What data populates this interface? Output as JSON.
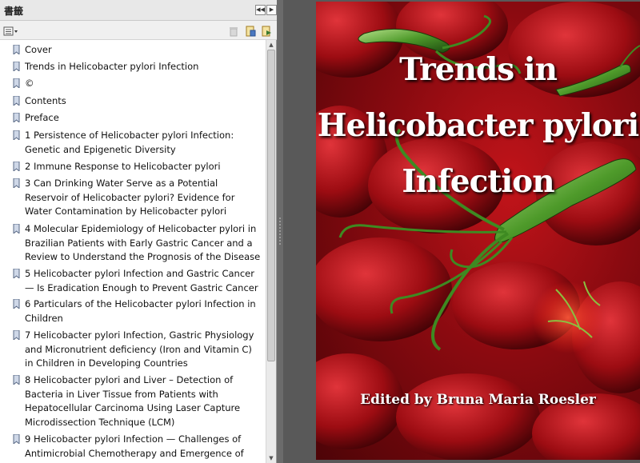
{
  "panel": {
    "title": "書籤"
  },
  "bookmarks": [
    {
      "label": "Cover"
    },
    {
      "label": "Trends in Helicobacter pylori Infection"
    },
    {
      "label": "©"
    },
    {
      "label": "Contents"
    },
    {
      "label": "Preface"
    },
    {
      "label": "1 Persistence of Helicobacter pylori Infection: Genetic and Epigenetic Diversity"
    },
    {
      "label": "2 Immune Response to Helicobacter pylori"
    },
    {
      "label": "3 Can Drinking Water Serve as a Potential Reservoir of Helicobacter pylori? Evidence for Water Contamination by Helicobacter pylori"
    },
    {
      "label": "4 Molecular Epidemiology of Helicobacter pylori in Brazilian Patients with Early Gastric Cancer and a Review to Understand the Prognosis of the Disease"
    },
    {
      "label": "5 Helicobacter pylori Infection and Gastric Cancer — Is Eradication Enough to Prevent Gastric Cancer"
    },
    {
      "label": "6 Particulars of the Helicobacter pylori Infection in Children"
    },
    {
      "label": "7 Helicobacter pylori Infection, Gastric Physiology and Micronutrient deficiency (Iron and Vitamin C) in Children in Developing Countries"
    },
    {
      "label": "8 Helicobacter pylori and Liver – Detection of Bacteria in Liver Tissue from Patients with Hepatocellular Carcinoma Using Laser Capture Microdissection Technique (LCM)"
    },
    {
      "label": "9 Helicobacter pylori Infection — Challenges of Antimicrobial Chemotherapy and Emergence of"
    }
  ],
  "cover": {
    "title_lines": [
      "Trends in",
      "Helicobacter pylori",
      "Infection"
    ],
    "credit": "Edited by Bruna Maria Roesler"
  },
  "icons": {
    "collapse": "double-chevron-left-icon",
    "expand": "chevron-right-icon",
    "options": "options-menu-icon",
    "delete": "trash-icon",
    "new_bookmark": "new-bookmark-icon",
    "expand_bookmark": "expand-bookmark-icon",
    "bookmark": "bookmark-icon"
  }
}
